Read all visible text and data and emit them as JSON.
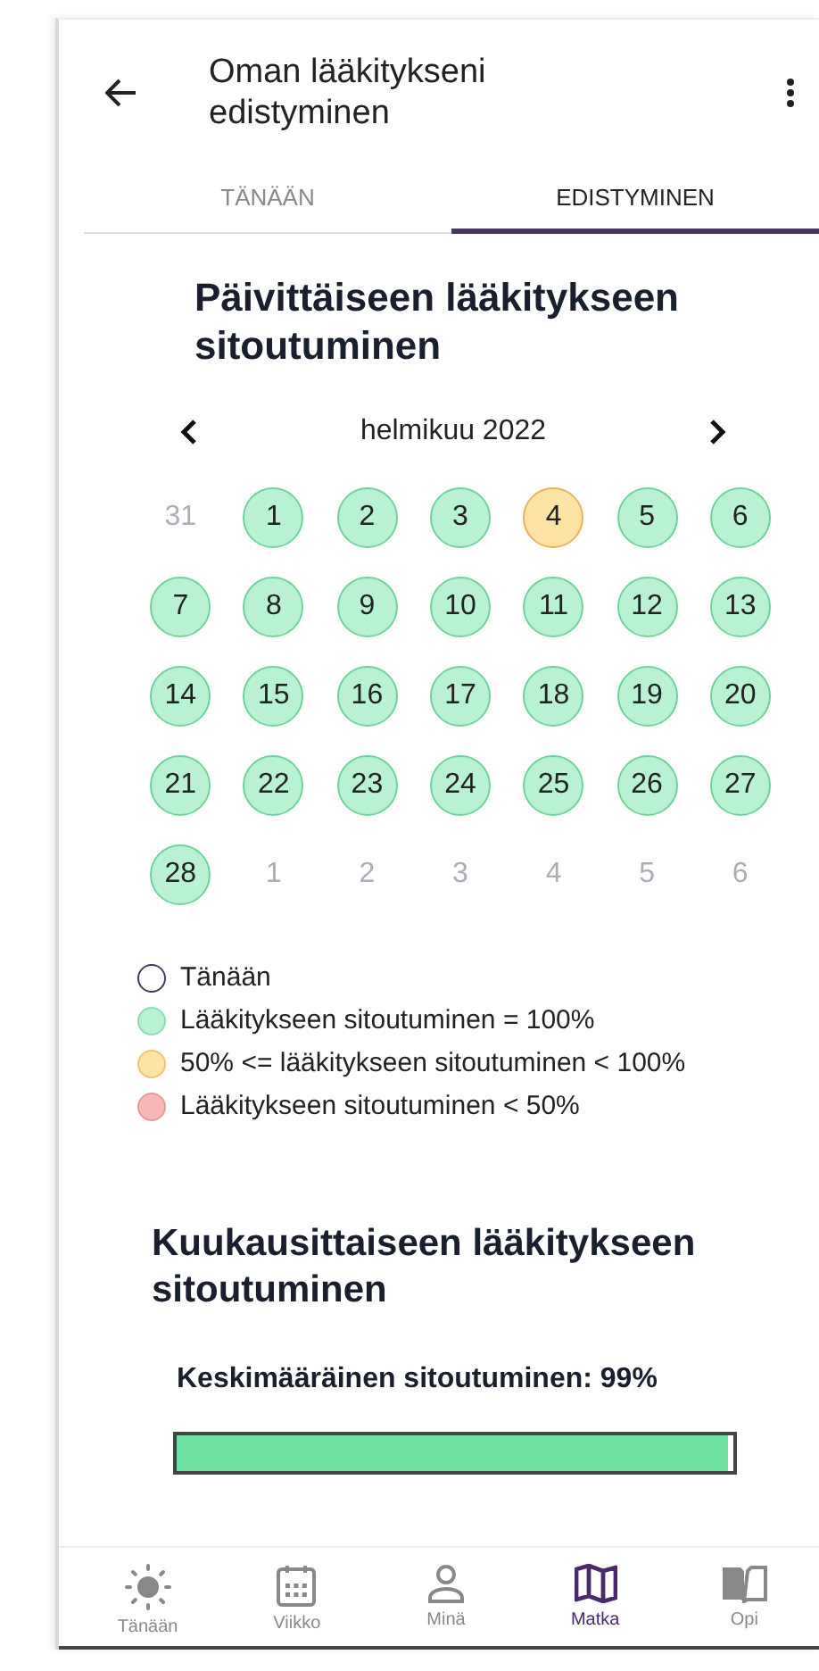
{
  "header": {
    "title": "Oman lääkitykseni edistyminen"
  },
  "tabs": [
    {
      "label": "TÄNÄÄN",
      "selected": false
    },
    {
      "label": "EDISTYMINEN",
      "selected": true
    }
  ],
  "daily": {
    "title": "Päivittäiseen lääkitykseen sitoutuminen",
    "month": "helmikuu 2022",
    "days": [
      {
        "label": "31",
        "kind": "outside"
      },
      {
        "label": "1",
        "kind": "full"
      },
      {
        "label": "2",
        "kind": "full"
      },
      {
        "label": "3",
        "kind": "full"
      },
      {
        "label": "4",
        "kind": "partial"
      },
      {
        "label": "5",
        "kind": "full"
      },
      {
        "label": "6",
        "kind": "full"
      },
      {
        "label": "7",
        "kind": "full"
      },
      {
        "label": "8",
        "kind": "full"
      },
      {
        "label": "9",
        "kind": "full"
      },
      {
        "label": "10",
        "kind": "full"
      },
      {
        "label": "11",
        "kind": "full"
      },
      {
        "label": "12",
        "kind": "full"
      },
      {
        "label": "13",
        "kind": "full"
      },
      {
        "label": "14",
        "kind": "full"
      },
      {
        "label": "15",
        "kind": "full"
      },
      {
        "label": "16",
        "kind": "full"
      },
      {
        "label": "17",
        "kind": "full"
      },
      {
        "label": "18",
        "kind": "full"
      },
      {
        "label": "19",
        "kind": "full"
      },
      {
        "label": "20",
        "kind": "full"
      },
      {
        "label": "21",
        "kind": "full"
      },
      {
        "label": "22",
        "kind": "full"
      },
      {
        "label": "23",
        "kind": "full"
      },
      {
        "label": "24",
        "kind": "full"
      },
      {
        "label": "25",
        "kind": "full"
      },
      {
        "label": "26",
        "kind": "full"
      },
      {
        "label": "27",
        "kind": "full"
      },
      {
        "label": "28",
        "kind": "full"
      },
      {
        "label": "1",
        "kind": "outside"
      },
      {
        "label": "2",
        "kind": "outside"
      },
      {
        "label": "3",
        "kind": "outside"
      },
      {
        "label": "4",
        "kind": "outside"
      },
      {
        "label": "5",
        "kind": "outside"
      },
      {
        "label": "6",
        "kind": "outside"
      }
    ],
    "legend": [
      {
        "label": "Tänään",
        "kind": "today"
      },
      {
        "label": "Lääkitykseen sitoutuminen = 100%",
        "kind": "full"
      },
      {
        "label": "50% <= lääkitykseen sitoutuminen < 100%",
        "kind": "partial"
      },
      {
        "label": "Lääkitykseen sitoutuminen < 50%",
        "kind": "low"
      }
    ]
  },
  "monthly": {
    "title": "Kuukausittaiseen lääkitykseen sitoutuminen",
    "average": "Keskimääräinen sitoutuminen: 99%",
    "level": 0.99
  },
  "bottom_nav": [
    {
      "label": "Tänään",
      "selected": false
    },
    {
      "label": "Viikko",
      "selected": false
    },
    {
      "label": "Minä",
      "selected": false
    },
    {
      "label": "Matka",
      "selected": true
    },
    {
      "label": "Opi",
      "selected": false
    }
  ]
}
